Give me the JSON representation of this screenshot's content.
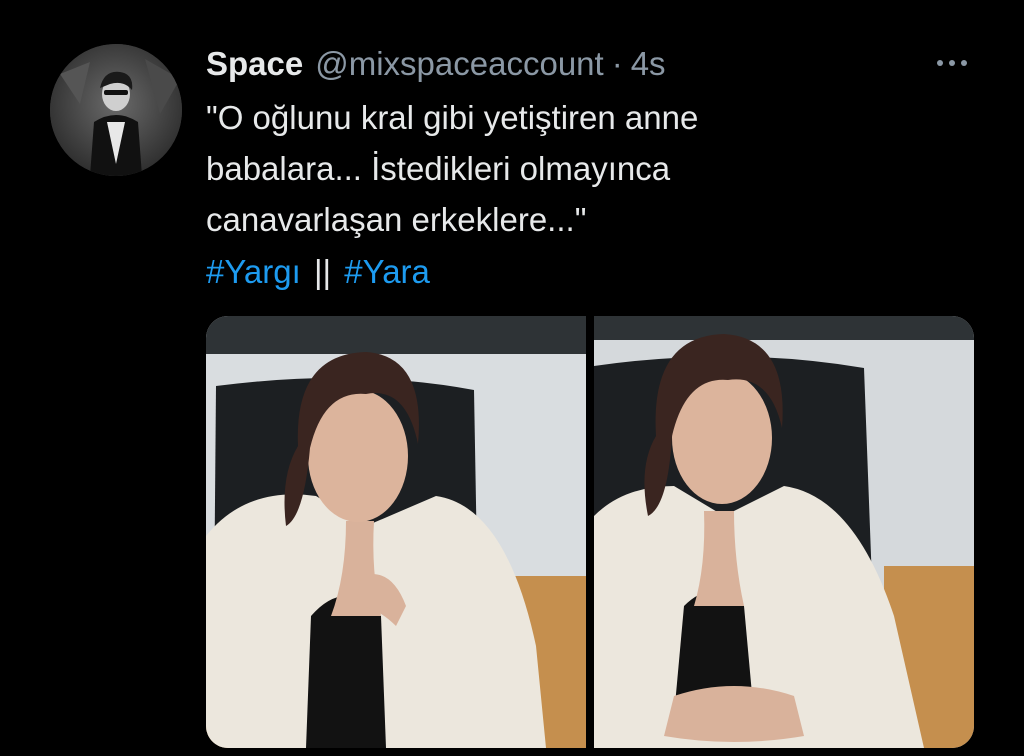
{
  "tweet": {
    "author": {
      "name": "Space",
      "handle": "@mixspaceaccount",
      "separator": "·",
      "time": "4s"
    },
    "text_lines": [
      "\"O oğlunu kral gibi yetiştiren anne",
      "babalara... İstedikleri olmayınca",
      "canavarlaşan erkeklere...\""
    ],
    "hashtags": [
      "#Yargı",
      "#Yara"
    ],
    "hashtag_separator": "||",
    "media_count": 2
  },
  "colors": {
    "background": "#000000",
    "text": "#e7e9ea",
    "secondary": "#8b98a5",
    "link": "#1d9bf0"
  },
  "icons": {
    "more": "more-horizontal-icon"
  }
}
